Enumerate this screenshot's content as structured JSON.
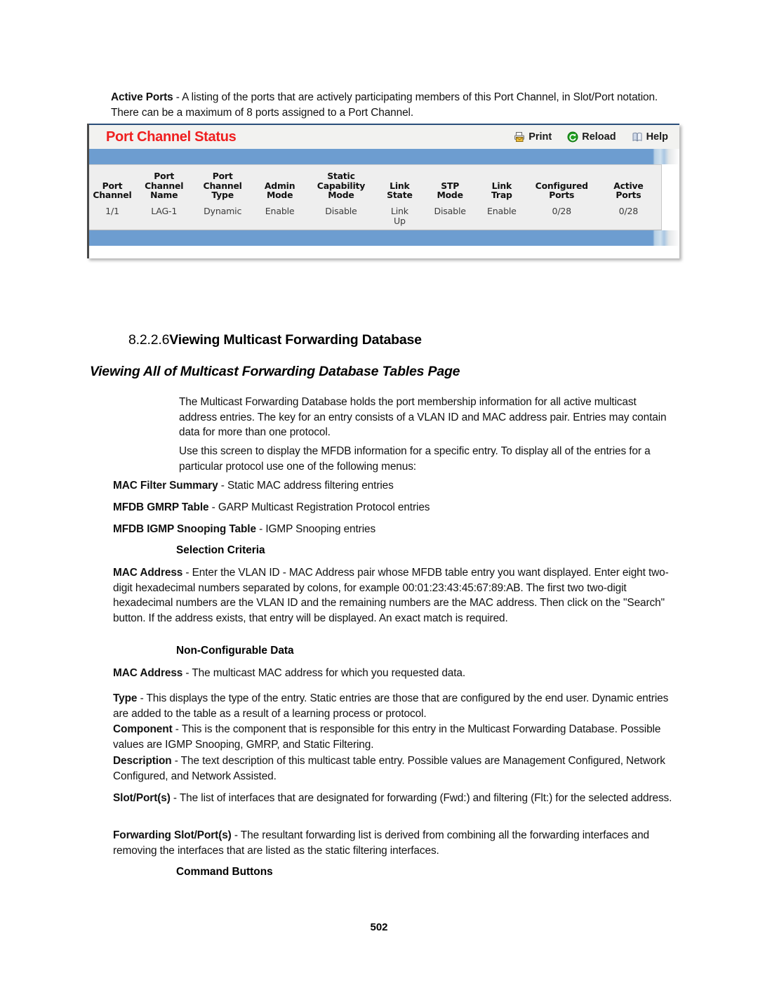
{
  "document": {
    "page_number": "502"
  },
  "intro": {
    "term": "Active Ports",
    "dash": " - ",
    "text": "A listing of the ports that are actively participating members of this Port Channel, in Slot/Port notation. There can be a maximum of 8 ports assigned to a Port Channel."
  },
  "device_panel": {
    "title": "Port Channel Status",
    "actions": [
      {
        "label": "Print",
        "icon": "printer-icon"
      },
      {
        "label": "Reload",
        "icon": "reload-icon"
      },
      {
        "label": "Help",
        "icon": "help-book-icon"
      }
    ],
    "table": {
      "headers": [
        "Port\nChannel",
        "Port\nChannel\nName",
        "Port\nChannel\nType",
        "Admin\nMode",
        "Static\nCapability\nMode",
        "Link\nState",
        "STP\nMode",
        "Link\nTrap",
        "Configured\nPorts",
        "Active\nPorts"
      ],
      "rows": [
        [
          "1/1",
          "LAG-1",
          "Dynamic",
          "Enable",
          "Disable",
          "Link\nUp",
          "Disable",
          "Enable",
          "0/28",
          "0/28"
        ]
      ]
    },
    "colors": {
      "title_red": "#ef1f1f",
      "bar_blue": "#6d9dd0",
      "table_bg": "#eeeeee"
    }
  },
  "section": {
    "number": "8.2.2.6",
    "title": "Viewing Multicast Forwarding Database",
    "subtitle": "Viewing All of Multicast Forwarding Database Tables Page"
  },
  "body": {
    "p1": "The Multicast Forwarding Database holds the port membership information for all active multicast address entries. The key for an entry consists of a VLAN ID and MAC address pair. Entries may contain data for more than one protocol.",
    "p2": "Use this screen to display the MFDB information for a specific entry. To display all of the entries for a particular protocol use one of the following menus:",
    "menu_items": [
      {
        "term": "MAC Filter Summary",
        "text": " - Static MAC address filtering entries"
      },
      {
        "term": "MFDB GMRP Table",
        "text": " - GARP Multicast Registration Protocol entries"
      },
      {
        "term": "MFDB IGMP Snooping Table",
        "text": " - IGMP Snooping entries"
      }
    ],
    "selection_criteria_heading": "Selection Criteria",
    "selection_criteria": {
      "term": "MAC Address",
      "text": " - Enter the VLAN ID - MAC Address pair whose MFDB table entry you want displayed. Enter eight two-digit hexadecimal numbers separated by colons, for example 00:01:23:43:45:67:89:AB. The first two two-digit hexadecimal numbers are the VLAN ID and the remaining numbers are the MAC address. Then click on the \"Search\" button. If the address exists, that entry will be displayed. An exact match is required."
    },
    "non_configurable_heading": "Non-Configurable Data",
    "non_configurable": [
      {
        "term": "MAC Address",
        "text": " - The multicast MAC address for which you requested data."
      },
      {
        "term": "Type",
        "text": " - This displays the type of the entry. Static entries are those that are configured by the end user. Dynamic entries are added to the table as a result of a learning process or protocol."
      },
      {
        "term": "Component",
        "text": " - This is the component that is responsible for this entry in the Multicast Forwarding Database. Possible values are IGMP Snooping, GMRP, and Static Filtering."
      },
      {
        "term": "Description",
        "text": " - The text description of this multicast table entry. Possible values are Management Configured, Network Configured, and Network Assisted."
      },
      {
        "term": "Slot/Port(s)",
        "text": " - The list of interfaces that are designated for forwarding (Fwd:) and filtering (Flt:) for the selected address."
      },
      {
        "term": "Forwarding Slot/Port(s)",
        "text": " - The resultant forwarding list is derived from combining all the forwarding interfaces and removing the interfaces that are listed as the static filtering interfaces."
      }
    ],
    "command_buttons_heading": "Command Buttons"
  }
}
